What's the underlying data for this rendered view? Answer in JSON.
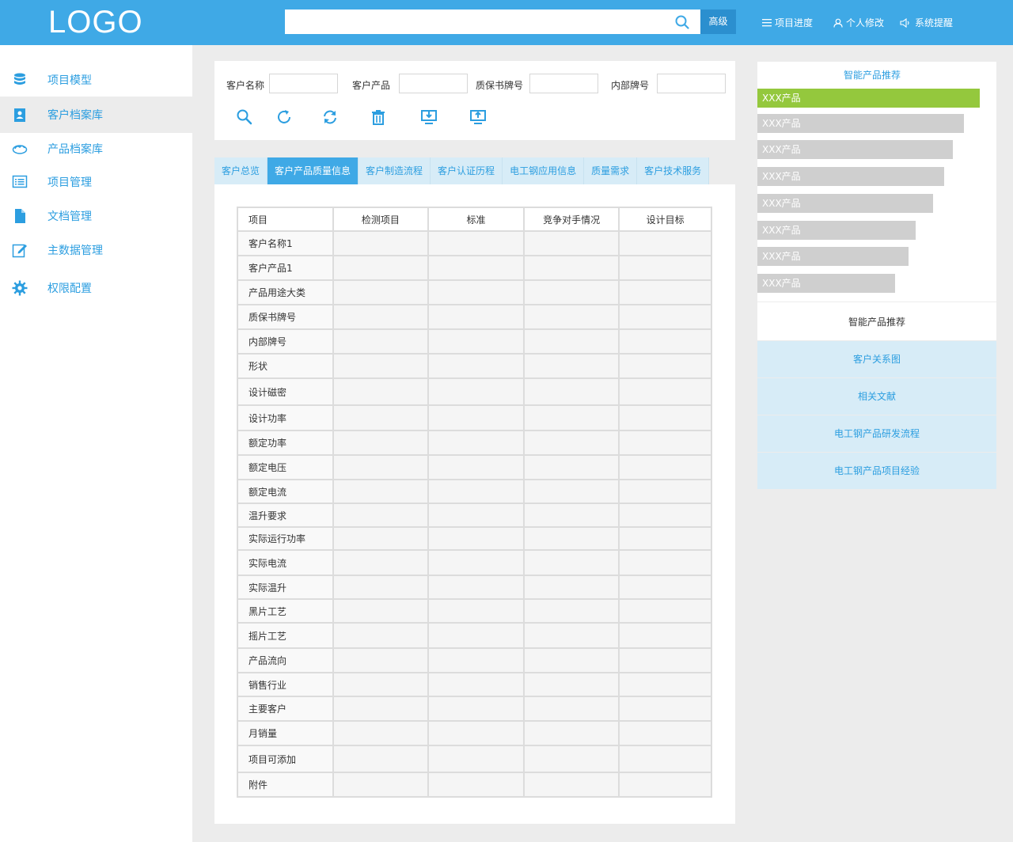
{
  "header": {
    "logo": "LOGO",
    "search_placeholder": "",
    "advanced_label": "高级",
    "nav": [
      {
        "label": "项目进度",
        "icon": "menu-icon"
      },
      {
        "label": "个人修改",
        "icon": "user-icon"
      },
      {
        "label": "系统提醒",
        "icon": "speaker-icon"
      }
    ]
  },
  "sidebar": {
    "items": [
      {
        "label": "项目模型",
        "icon": "database-icon",
        "active": false
      },
      {
        "label": "客户档案库",
        "icon": "contact-book-icon",
        "active": true
      },
      {
        "label": "产品档案库",
        "icon": "cloud-icon",
        "active": false
      },
      {
        "label": "项目管理",
        "icon": "list-icon",
        "active": false
      },
      {
        "label": "文档管理",
        "icon": "document-icon",
        "active": false
      },
      {
        "label": "主数据管理",
        "icon": "edit-icon",
        "active": false
      },
      {
        "label": "权限配置",
        "icon": "gear-icon",
        "active": false
      }
    ]
  },
  "filters": [
    {
      "label": "客户名称",
      "value": ""
    },
    {
      "label": "客户产品",
      "value": ""
    },
    {
      "label": "质保书牌号",
      "value": ""
    },
    {
      "label": "内部牌号",
      "value": ""
    }
  ],
  "toolbar": [
    {
      "icon": "search-icon"
    },
    {
      "icon": "refresh-icon"
    },
    {
      "icon": "sync-icon"
    },
    {
      "icon": "trash-icon"
    },
    {
      "icon": "import-icon"
    },
    {
      "icon": "export-icon"
    }
  ],
  "tabs": [
    {
      "label": "客户总览",
      "active": false
    },
    {
      "label": "客户产品质量信息",
      "active": true
    },
    {
      "label": "客户制造流程",
      "active": false
    },
    {
      "label": "客户认证历程",
      "active": false
    },
    {
      "label": "电工钢应用信息",
      "active": false
    },
    {
      "label": "质量需求",
      "active": false
    },
    {
      "label": "客户技术服务",
      "active": false
    }
  ],
  "table": {
    "headers": [
      "项目",
      "检测项目",
      "标准",
      "竞争对手情况",
      "设计目标"
    ],
    "rows": [
      "客户名称1",
      "客户产品1",
      "产品用途大类",
      "质保书牌号",
      "内部牌号",
      "形状",
      "设计磁密",
      "设计功率",
      "额定功率",
      "额定电压",
      "额定电流",
      "温升要求",
      "实际运行功率",
      "实际电流",
      "实际温升",
      "黑片工艺",
      "摇片工艺",
      "产品流向",
      "销售行业",
      "主要客户",
      "月销量",
      "项目可添加",
      "附件"
    ]
  },
  "recommend": {
    "title": "智能产品推荐",
    "products": [
      {
        "label": "XXX产品",
        "value": 1.0
      },
      {
        "label": "XXX产品",
        "value": 0.93
      },
      {
        "label": "XXX产品",
        "value": 0.88
      },
      {
        "label": "XXX产品",
        "value": 0.84
      },
      {
        "label": "XXX产品",
        "value": 0.79
      },
      {
        "label": "XXX产品",
        "value": 0.71
      },
      {
        "label": "XXX产品",
        "value": 0.68
      },
      {
        "label": "XXX产品",
        "value": 0.62
      }
    ],
    "section_title": "智能产品推荐",
    "links": [
      "客户关系图",
      "相关文献",
      "电工钢产品研发流程",
      "电工钢产品项目经验"
    ]
  },
  "colors": {
    "primary": "#3fa9e6",
    "accent_text": "#2c9ee0",
    "highlight_bar": "#94c83d",
    "bar": "#cfcfcf",
    "tab_bg": "#d7ecf7"
  }
}
